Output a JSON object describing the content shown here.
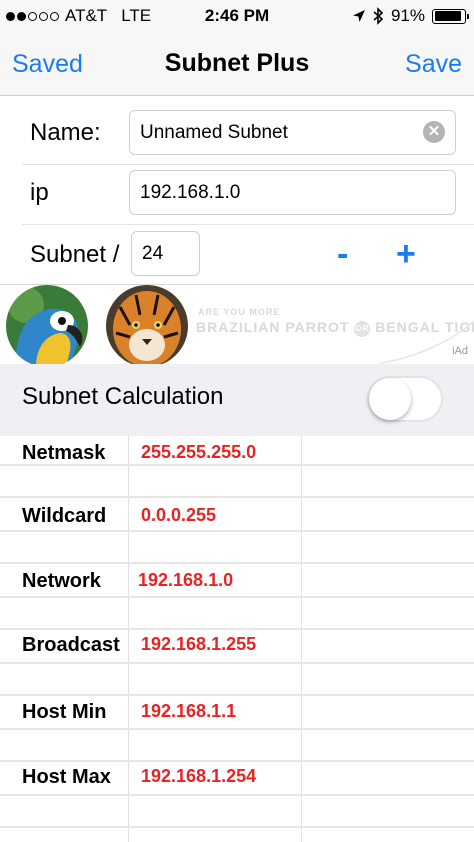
{
  "status_bar": {
    "signal_bars_filled": 2,
    "signal_bars_total": 5,
    "carrier": "AT&T",
    "network": "LTE",
    "time": "2:46 PM",
    "battery": "91%",
    "battery_level": 0.91
  },
  "nav": {
    "back_label": "Saved",
    "title": "Subnet Plus",
    "save_label": "Save"
  },
  "form": {
    "name_label": "Name:",
    "name_value": "Unnamed Subnet",
    "clear_icon": "✕",
    "ip_label": "ip",
    "ip_value": "192.168.1.0",
    "subnet_label": "Subnet /",
    "subnet_value": "24",
    "minus_label": "-",
    "plus_label": "+"
  },
  "ad": {
    "tagline": "ARE YOU MORE",
    "option_a": "BRAZILIAN PARROT",
    "or_label": "OR",
    "option_b": "BENGAL TIGER?",
    "badge": "iAd"
  },
  "calc": {
    "title": "Subnet Calculation",
    "toggle_on": false
  },
  "results": [
    {
      "label": "Netmask",
      "value": "255.255.255.0"
    },
    {
      "label": "Wildcard",
      "value": "0.0.0.255"
    },
    {
      "label": "Network",
      "value": "192.168.1.0"
    },
    {
      "label": "Broadcast",
      "value": "192.168.1.255"
    },
    {
      "label": "Host Min",
      "value": "192.168.1.1"
    },
    {
      "label": "Host Max",
      "value": "192.168.1.254"
    }
  ],
  "colors": {
    "accent": "#1a7cf5",
    "result_value": "#e82323",
    "section_bg": "#efeff4"
  }
}
